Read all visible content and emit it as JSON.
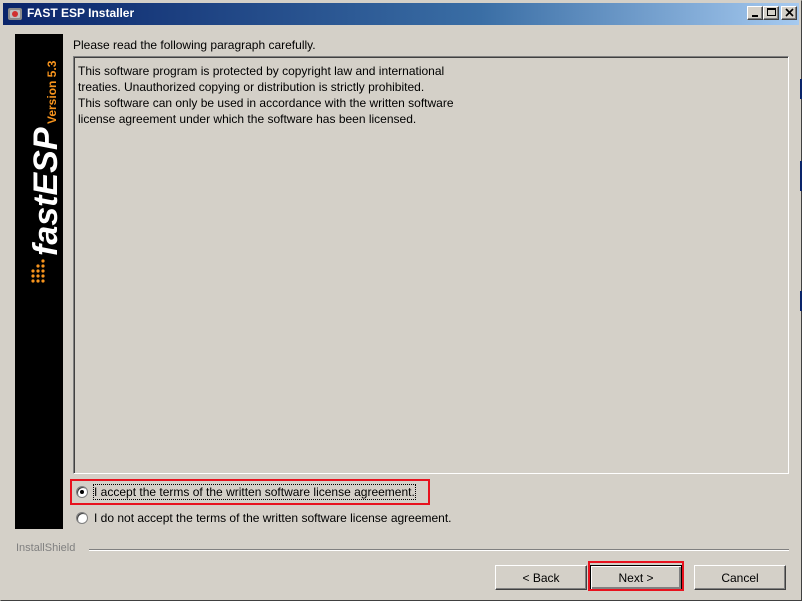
{
  "window": {
    "title": "FAST ESP Installer"
  },
  "banner": {
    "brand": "fastESP",
    "version": "Version 5.3"
  },
  "instruction": "Please read the following paragraph carefully.",
  "license": {
    "lines": [
      "This software program is protected by copyright law and international",
      "treaties. Unauthorized copying or distribution is strictly prohibited.",
      "This software can only be used in accordance with the written software",
      "license agreement under which the software has been licensed."
    ]
  },
  "options": {
    "accept_label": "I accept the terms of the written software license agreement.",
    "decline_label": "I do not accept the terms of the written software license agreement.",
    "selected": "accept"
  },
  "footer": {
    "brand": "InstallShield"
  },
  "buttons": {
    "back": "< Back",
    "next": "Next >",
    "cancel": "Cancel"
  },
  "colors": {
    "highlight": "#e8121e",
    "brand_accent": "#f7941d"
  }
}
